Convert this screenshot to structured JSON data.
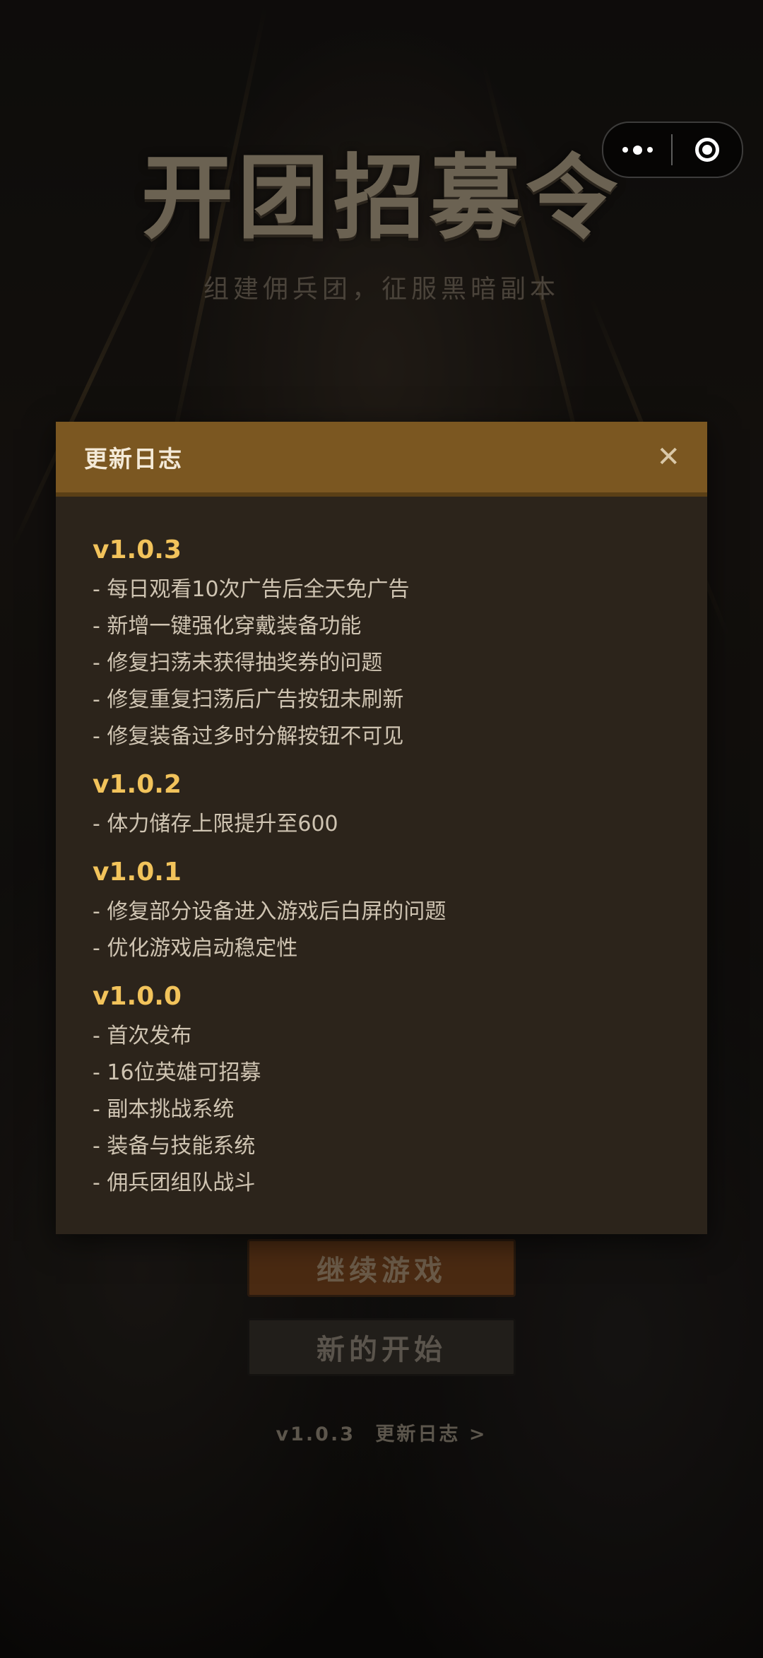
{
  "capsule": {
    "more_icon": "more-dots-icon",
    "close_icon": "target-circle-icon"
  },
  "header": {
    "title": "开团招募令",
    "subtitle": "组建佣兵团，征服黑暗副本"
  },
  "menu": {
    "continue_label": "继续游戏",
    "new_game_label": "新的开始",
    "version": "v1.0.3",
    "changelog_link": "更新日志 >"
  },
  "modal": {
    "title": "更新日志",
    "close_symbol": "✕",
    "versions": [
      {
        "version": "v1.0.3",
        "items": [
          "- 每日观看10次广告后全天免广告",
          "- 新增一键强化穿戴装备功能",
          "- 修复扫荡未获得抽奖券的问题",
          "- 修复重复扫荡后广告按钮未刷新",
          "- 修复装备过多时分解按钮不可见"
        ]
      },
      {
        "version": "v1.0.2",
        "items": [
          "- 体力储存上限提升至600"
        ]
      },
      {
        "version": "v1.0.1",
        "items": [
          "- 修复部分设备进入游戏后白屏的问题",
          "- 优化游戏启动稳定性"
        ]
      },
      {
        "version": "v1.0.0",
        "items": [
          "- 首次发布",
          "- 16位英雄可招募",
          "- 副本挑战系统",
          "- 装备与技能系统",
          "- 佣兵团组队战斗"
        ]
      }
    ]
  },
  "colors": {
    "modal_header": "#7b5721",
    "modal_body": "#2c241b",
    "version_accent": "#f2c35b",
    "continue_button": "#4a2a12"
  }
}
